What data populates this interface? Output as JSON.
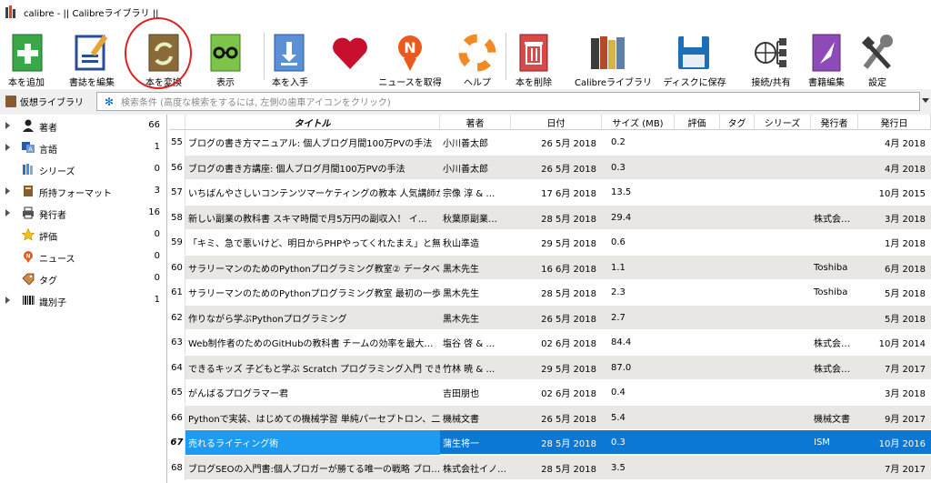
{
  "window": {
    "title": "calibre - || Calibreライブラリ ||"
  },
  "toolbar": {
    "add": "本を追加",
    "edit_meta": "書誌を編集",
    "convert": "本を変換",
    "view": "表示",
    "get_books": "本を入手",
    "fetch_news": "ニュースを取得",
    "help": "ヘルプ",
    "remove": "本を削除",
    "library": "Calibreライブラリ",
    "save_disk": "ディスクに保存",
    "connect": "接続/共有",
    "edit_book": "書籍編集",
    "prefs": "設定"
  },
  "search": {
    "virtual_library": "仮想ライブラリ",
    "placeholder": "検索条件 (高度な検索をするには, 左側の歯車アイコンをクリック)"
  },
  "sidebar": {
    "items": [
      {
        "label": "著者",
        "count": "66"
      },
      {
        "label": "言語",
        "count": "1"
      },
      {
        "label": "シリーズ",
        "count": "0"
      },
      {
        "label": "所持フォーマット",
        "count": "3"
      },
      {
        "label": "発行者",
        "count": "16"
      },
      {
        "label": "評価",
        "count": "0"
      },
      {
        "label": "ニュース",
        "count": "0"
      },
      {
        "label": "タグ",
        "count": "0"
      },
      {
        "label": "識別子",
        "count": "1"
      }
    ]
  },
  "table": {
    "headers": {
      "title": "タイトル",
      "author": "著者",
      "date": "日付",
      "size": "サイズ (MB)",
      "rating": "評価",
      "tags": "タグ",
      "series": "シリーズ",
      "publisher": "発行者",
      "pubdate": "発行日"
    },
    "rows": [
      {
        "n": "55",
        "title": "ブログの書き方マニュアル: 個人ブログ月間100万PVの手法",
        "author": "小川善太郎",
        "date": "26  5月 2018",
        "size": "0.2",
        "publisher": "",
        "pubdate": "4月 2018"
      },
      {
        "n": "56",
        "title": "ブログの書き方講座: 個人ブログ月間100万PVの手法",
        "author": "小川善太郎",
        "date": "26  5月 2018",
        "size": "0.3",
        "publisher": "",
        "pubdate": "4月 2018"
      },
      {
        "n": "57",
        "title": "いちばんやさしいコンテンツマーケティングの教本 人気講師が…",
        "author": "宗像 淳 & …",
        "date": "17  6月 2018",
        "size": "13.5",
        "publisher": "",
        "pubdate": "10月 2015"
      },
      {
        "n": "58",
        "title": "新しい副業の教科書 スキマ時間で月5万円の副収入！ イ…",
        "author": "秋葉原副業…",
        "date": "28  5月 2018",
        "size": "29.4",
        "publisher": "株式会…",
        "pubdate": "3月 2018"
      },
      {
        "n": "59",
        "title": "「キミ、急で悪いけど、明日からPHPやってくれたまえ」と無茶…",
        "author": "秋山準造",
        "date": "29  5月 2018",
        "size": "0.6",
        "publisher": "",
        "pubdate": "1月 2018"
      },
      {
        "n": "60",
        "title": "サラリーマンのためのPythonプログラミング教室② データベー…",
        "author": "黒木先生",
        "date": "16  6月 2018",
        "size": "1.1",
        "publisher": "Toshiba",
        "pubdate": "6月 2018"
      },
      {
        "n": "61",
        "title": "サラリーマンのためのPythonプログラミング教室 最初の一歩編",
        "author": "黒木先生",
        "date": "28  5月 2018",
        "size": "2.3",
        "publisher": "Toshiba",
        "pubdate": "5月 2018"
      },
      {
        "n": "62",
        "title": "作りながら学ぶPythonプログラミング",
        "author": "黒木先生",
        "date": "26  5月 2018",
        "size": "2.7",
        "publisher": "",
        "pubdate": "5月 2018"
      },
      {
        "n": "63",
        "title": "Web制作者のためのGitHubの教科書 チームの効率を最大…",
        "author": "塩谷 啓 & …",
        "date": "02  6月 2018",
        "size": "84.4",
        "publisher": "株式会…",
        "pubdate": "10月 2014"
      },
      {
        "n": "64",
        "title": "できるキッズ 子どもと学ぶ Scratch プログラミング入門 でき…",
        "author": "竹林 暁 & …",
        "date": "29  5月 2018",
        "size": "87.0",
        "publisher": "株式会…",
        "pubdate": "7月 2017"
      },
      {
        "n": "65",
        "title": "がんばるプログラマー君",
        "author": "吉田朋也",
        "date": "02  6月 2018",
        "size": "0.4",
        "publisher": "",
        "pubdate": "3月 2018"
      },
      {
        "n": "66",
        "title": "Pythonで実装、はじめての機械学習 単純パーセプトロン、二…",
        "author": "機械文書",
        "date": "26  5月 2018",
        "size": "5.4",
        "publisher": "機械文書",
        "pubdate": "9月 2017"
      },
      {
        "n": "67",
        "title": "売れるライティング術",
        "author": "蒲生将一",
        "date": "28  5月 2018",
        "size": "0.3",
        "publisher": "ISM",
        "pubdate": "10月 2016"
      },
      {
        "n": "68",
        "title": "ブログSEOの入門書:個人ブロガーが勝てる唯一の戦略 ブロ…",
        "author": "株式会社イノ…",
        "date": "28  5月 2018",
        "size": "3.5",
        "publisher": "",
        "pubdate": "7月 2017"
      }
    ]
  },
  "colors": {
    "selection": "#0a78d4",
    "selection_title": "#1d9bf0",
    "alt_row": "#e9e7e3",
    "annotation": "#dd2222"
  }
}
